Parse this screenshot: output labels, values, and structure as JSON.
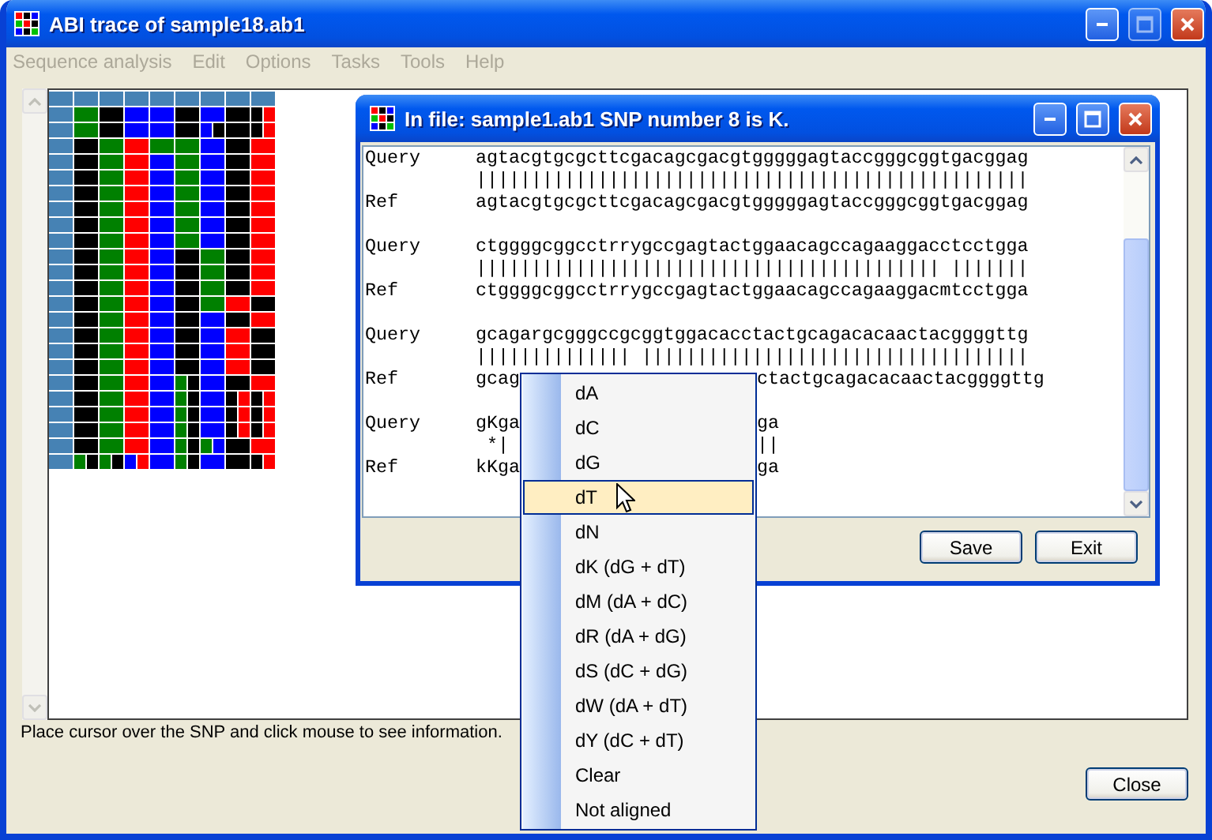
{
  "window": {
    "title": "ABI trace of sample18.ab1"
  },
  "menu_bar": [
    {
      "label": "Sequence analysis",
      "disabled": true
    },
    {
      "label": "Edit",
      "disabled": true
    },
    {
      "label": "Options",
      "disabled": true
    },
    {
      "label": "Tasks",
      "disabled": true
    },
    {
      "label": "Tools",
      "disabled": true
    },
    {
      "label": "Help",
      "disabled": true
    }
  ],
  "dialog": {
    "title": "In file: sample1.ab1 SNP number 8 is K.",
    "blocks": [
      {
        "lines": [
          {
            "label": "Query",
            "sequence": "agtacgtgcgcttcgacagcgacgtgggggagtaccgggcggtgacggag"
          },
          {
            "sequence": "||||||||||||||||||||||||||||||||||||||||||||||||||"
          },
          {
            "label": "Ref",
            "sequence": "agtacgtgcgcttcgacagcgacgtgggggagtaccgggcggtgacggag"
          }
        ]
      },
      {
        "lines": [
          {
            "label": "Query",
            "sequence": "ctggggcggcctrrygccgagtactggaacagccagaaggacctcctgga"
          },
          {
            "sequence": "|||||||||||||||||||||||||||||||||||||||||| |||||||"
          },
          {
            "label": "Ref",
            "sequence": "ctggggcggcctrrygccgagtactggaacagccagaaggacmtcctgga"
          }
        ]
      },
      {
        "lines": [
          {
            "label": "Query",
            "sequence": "gcagargcgggccgcggtggacacctactgcagacacaactacggggttg"
          },
          {
            "sequence": "|||||||||||||| |||||||||||||||||||||||||||||||||||"
          },
          {
            "label": "Ref",
            "segments": [
              "gcag",
              "ctactgcagacacaactacggggttg"
            ]
          }
        ]
      },
      {
        "lines": [
          {
            "label": "Query",
            "segments": [
              "gKga",
              "ga"
            ]
          },
          {
            "segments": [
              " *|",
              "||"
            ]
          },
          {
            "label": "Ref",
            "segments": [
              "kKga",
              "ga"
            ]
          }
        ]
      }
    ],
    "buttons": [
      "Save",
      "Exit"
    ]
  },
  "context_menu": {
    "items": [
      {
        "label": "dA",
        "selected": false
      },
      {
        "label": "dC",
        "selected": false
      },
      {
        "label": "dG",
        "selected": false
      },
      {
        "label": "dT",
        "selected": true
      },
      {
        "label": "dN",
        "selected": false
      },
      {
        "label": "dK (dG + dT)",
        "selected": false
      },
      {
        "label": "dM (dA + dC)",
        "selected": false
      },
      {
        "label": "dR (dA + dG)",
        "selected": false
      },
      {
        "label": "dS (dC + dG)",
        "selected": false
      },
      {
        "label": "dW (dA + dT)",
        "selected": false
      },
      {
        "label": "dY (dC + dT)",
        "selected": false
      },
      {
        "label": "Clear",
        "selected": false
      },
      {
        "label": "Not aligned",
        "selected": false
      }
    ]
  },
  "status_text": "Place cursor over the SNP and click mouse to see information.",
  "close_button": "Close"
}
